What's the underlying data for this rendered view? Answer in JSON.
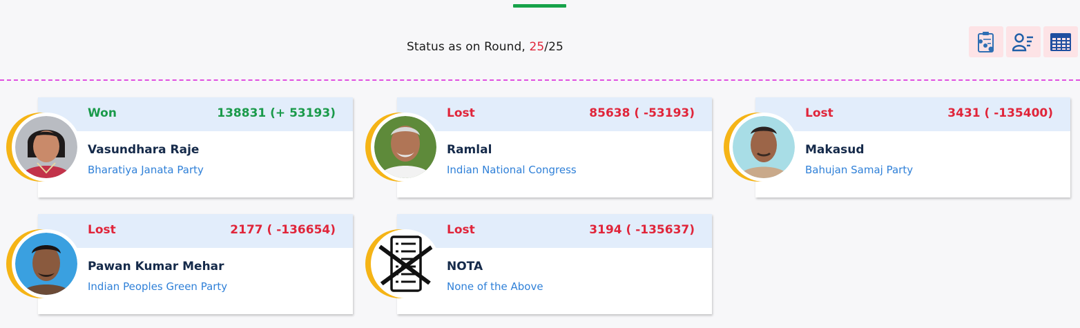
{
  "header": {
    "status_label": "Status as on Round,",
    "current_round": "25",
    "separator": "/",
    "total_rounds": "25"
  },
  "toolbar": {
    "buttons": [
      {
        "icon": "clipboard-report-icon"
      },
      {
        "icon": "candidate-list-icon"
      },
      {
        "icon": "table-grid-icon"
      }
    ]
  },
  "colors": {
    "won": "#1a9a4a",
    "lost": "#e0253a",
    "accent_bar": "#17a34a",
    "divider": "#e04ee0",
    "ring": "#f5b416",
    "card_header": "#e2edfb",
    "party_link": "#2f80d8"
  },
  "candidates": [
    {
      "status": "Won",
      "votes": "138831 (+ 53193)",
      "name": "Vasundhara Raje",
      "party": "Bharatiya Janata Party",
      "photo": "candidate-photo"
    },
    {
      "status": "Lost",
      "votes": "85638 ( -53193)",
      "name": "Ramlal",
      "party": "Indian National Congress",
      "photo": "candidate-photo"
    },
    {
      "status": "Lost",
      "votes": "3431 ( -135400)",
      "name": "Makasud",
      "party": "Bahujan Samaj Party",
      "photo": "candidate-photo"
    },
    {
      "status": "Lost",
      "votes": "2177 ( -136654)",
      "name": "Pawan Kumar Mehar",
      "party": "Indian Peoples Green Party",
      "photo": "candidate-photo"
    },
    {
      "status": "Lost",
      "votes": "3194 ( -135637)",
      "name": "NOTA",
      "party": "None of the Above",
      "photo": "nota-symbol"
    }
  ]
}
